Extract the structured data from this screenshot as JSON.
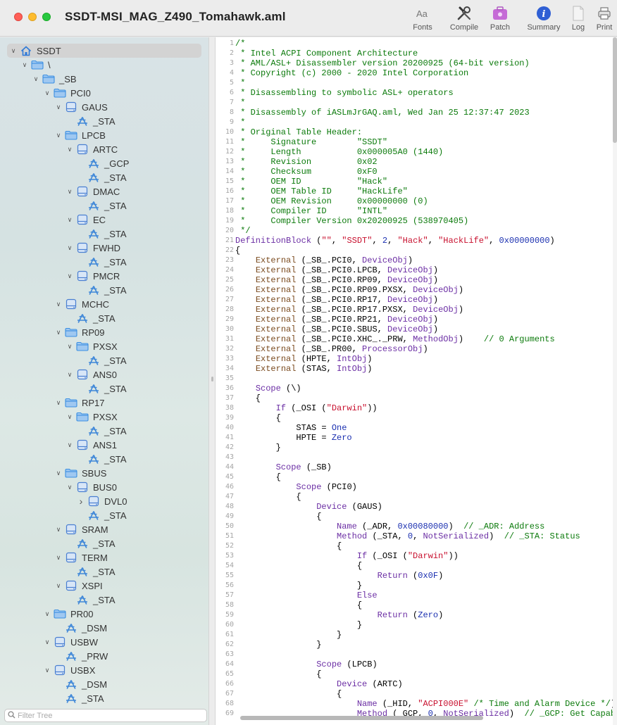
{
  "window": {
    "title": "SSDT-MSI_MAG_Z490_Tomahawk.aml"
  },
  "toolbar": {
    "fonts": {
      "label": "Fonts",
      "icon": "fonts-icon"
    },
    "compile": {
      "label": "Compile",
      "icon": "wrench-screwdriver-icon"
    },
    "patch": {
      "label": "Patch",
      "icon": "patch-case-icon"
    },
    "summary": {
      "label": "Summary",
      "icon": "info-icon"
    },
    "log": {
      "label": "Log",
      "icon": "document-icon"
    },
    "print": {
      "label": "Print",
      "icon": "printer-icon"
    }
  },
  "colors": {
    "folder": "#3b8fe2",
    "device": "#4a7fd1",
    "method": "#3d86d8",
    "selection": "#d3d3d3"
  },
  "tree": [
    {
      "label": "SSDT",
      "depth": 0,
      "icon": "house-icon",
      "expanded": true,
      "selected": true
    },
    {
      "label": "\\",
      "depth": 1,
      "icon": "folder-icon",
      "expanded": true
    },
    {
      "label": "_SB",
      "depth": 2,
      "icon": "folder-icon",
      "expanded": true
    },
    {
      "label": "PCI0",
      "depth": 3,
      "icon": "folder-icon",
      "expanded": true
    },
    {
      "label": "GAUS",
      "depth": 4,
      "icon": "device-icon",
      "expanded": true
    },
    {
      "label": "_STA",
      "depth": 5,
      "icon": "method-icon"
    },
    {
      "label": "LPCB",
      "depth": 4,
      "icon": "folder-icon",
      "expanded": true
    },
    {
      "label": "ARTC",
      "depth": 5,
      "icon": "device-icon",
      "expanded": true
    },
    {
      "label": "_GCP",
      "depth": 6,
      "icon": "method-icon"
    },
    {
      "label": "_STA",
      "depth": 6,
      "icon": "method-icon"
    },
    {
      "label": "DMAC",
      "depth": 5,
      "icon": "device-icon",
      "expanded": true
    },
    {
      "label": "_STA",
      "depth": 6,
      "icon": "method-icon"
    },
    {
      "label": "EC",
      "depth": 5,
      "icon": "device-icon",
      "expanded": true
    },
    {
      "label": "_STA",
      "depth": 6,
      "icon": "method-icon"
    },
    {
      "label": "FWHD",
      "depth": 5,
      "icon": "device-icon",
      "expanded": true
    },
    {
      "label": "_STA",
      "depth": 6,
      "icon": "method-icon"
    },
    {
      "label": "PMCR",
      "depth": 5,
      "icon": "device-icon",
      "expanded": true
    },
    {
      "label": "_STA",
      "depth": 6,
      "icon": "method-icon"
    },
    {
      "label": "MCHC",
      "depth": 4,
      "icon": "device-icon",
      "expanded": true
    },
    {
      "label": "_STA",
      "depth": 5,
      "icon": "method-icon"
    },
    {
      "label": "RP09",
      "depth": 4,
      "icon": "folder-icon",
      "expanded": true
    },
    {
      "label": "PXSX",
      "depth": 5,
      "icon": "folder-icon",
      "expanded": true
    },
    {
      "label": "_STA",
      "depth": 6,
      "icon": "method-icon"
    },
    {
      "label": "ANS0",
      "depth": 5,
      "icon": "device-icon",
      "expanded": true
    },
    {
      "label": "_STA",
      "depth": 6,
      "icon": "method-icon"
    },
    {
      "label": "RP17",
      "depth": 4,
      "icon": "folder-icon",
      "expanded": true
    },
    {
      "label": "PXSX",
      "depth": 5,
      "icon": "folder-icon",
      "expanded": true
    },
    {
      "label": "_STA",
      "depth": 6,
      "icon": "method-icon"
    },
    {
      "label": "ANS1",
      "depth": 5,
      "icon": "device-icon",
      "expanded": true
    },
    {
      "label": "_STA",
      "depth": 6,
      "icon": "method-icon"
    },
    {
      "label": "SBUS",
      "depth": 4,
      "icon": "folder-icon",
      "expanded": true
    },
    {
      "label": "BUS0",
      "depth": 5,
      "icon": "device-icon",
      "expanded": true
    },
    {
      "label": "DVL0",
      "depth": 6,
      "icon": "device-icon",
      "expanded": false
    },
    {
      "label": "_STA",
      "depth": 6,
      "icon": "method-icon"
    },
    {
      "label": "SRAM",
      "depth": 4,
      "icon": "device-icon",
      "expanded": true
    },
    {
      "label": "_STA",
      "depth": 5,
      "icon": "method-icon"
    },
    {
      "label": "TERM",
      "depth": 4,
      "icon": "device-icon",
      "expanded": true
    },
    {
      "label": "_STA",
      "depth": 5,
      "icon": "method-icon"
    },
    {
      "label": "XSPI",
      "depth": 4,
      "icon": "device-icon",
      "expanded": true
    },
    {
      "label": "_STA",
      "depth": 5,
      "icon": "method-icon"
    },
    {
      "label": "PR00",
      "depth": 3,
      "icon": "folder-icon",
      "expanded": true
    },
    {
      "label": "_DSM",
      "depth": 4,
      "icon": "method-icon"
    },
    {
      "label": "USBW",
      "depth": 3,
      "icon": "device-icon",
      "expanded": true
    },
    {
      "label": "_PRW",
      "depth": 4,
      "icon": "method-icon"
    },
    {
      "label": "USBX",
      "depth": 3,
      "icon": "device-icon",
      "expanded": true
    },
    {
      "label": "_DSM",
      "depth": 4,
      "icon": "method-icon"
    },
    {
      "label": "_STA",
      "depth": 4,
      "icon": "method-icon"
    }
  ],
  "filter": {
    "placeholder": "Filter Tree",
    "icon": "search-icon"
  },
  "code_lines": [
    [
      [
        "c",
        "/*"
      ]
    ],
    [
      [
        "c",
        " * Intel ACPI Component Architecture"
      ]
    ],
    [
      [
        "c",
        " * AML/ASL+ Disassembler version 20200925 (64-bit version)"
      ]
    ],
    [
      [
        "c",
        " * Copyright (c) 2000 - 2020 Intel Corporation"
      ]
    ],
    [
      [
        "c",
        " *"
      ]
    ],
    [
      [
        "c",
        " * Disassembling to symbolic ASL+ operators"
      ]
    ],
    [
      [
        "c",
        " *"
      ]
    ],
    [
      [
        "c",
        " * Disassembly of iASLmJrGAQ.aml, Wed Jan 25 12:37:47 2023"
      ]
    ],
    [
      [
        "c",
        " *"
      ]
    ],
    [
      [
        "c",
        " * Original Table Header:"
      ]
    ],
    [
      [
        "c",
        " *     Signature        \"SSDT\""
      ]
    ],
    [
      [
        "c",
        " *     Length           0x000005A0 (1440)"
      ]
    ],
    [
      [
        "c",
        " *     Revision         0x02"
      ]
    ],
    [
      [
        "c",
        " *     Checksum         0xF0"
      ]
    ],
    [
      [
        "c",
        " *     OEM ID           \"Hack\""
      ]
    ],
    [
      [
        "c",
        " *     OEM Table ID     \"HackLife\""
      ]
    ],
    [
      [
        "c",
        " *     OEM Revision     0x00000000 (0)"
      ]
    ],
    [
      [
        "c",
        " *     Compiler ID      \"INTL\""
      ]
    ],
    [
      [
        "c",
        " *     Compiler Version 0x20200925 (538970405)"
      ]
    ],
    [
      [
        "c",
        " */"
      ]
    ],
    [
      [
        "k",
        "DefinitionBlock"
      ],
      [
        "p",
        " ("
      ],
      [
        "s",
        "\"\""
      ],
      [
        "p",
        ", "
      ],
      [
        "s",
        "\"SSDT\""
      ],
      [
        "p",
        ", "
      ],
      [
        "n",
        "2"
      ],
      [
        "p",
        ", "
      ],
      [
        "s",
        "\"Hack\""
      ],
      [
        "p",
        ", "
      ],
      [
        "s",
        "\"HackLife\""
      ],
      [
        "p",
        ", "
      ],
      [
        "n",
        "0x00000000"
      ],
      [
        "p",
        ")"
      ]
    ],
    [
      [
        "p",
        "{"
      ]
    ],
    [
      [
        "p",
        "    "
      ],
      [
        "e",
        "External"
      ],
      [
        "p",
        " (_SB_.PCI0, "
      ],
      [
        "k",
        "DeviceObj"
      ],
      [
        "p",
        ")"
      ]
    ],
    [
      [
        "p",
        "    "
      ],
      [
        "e",
        "External"
      ],
      [
        "p",
        " (_SB_.PCI0.LPCB, "
      ],
      [
        "k",
        "DeviceObj"
      ],
      [
        "p",
        ")"
      ]
    ],
    [
      [
        "p",
        "    "
      ],
      [
        "e",
        "External"
      ],
      [
        "p",
        " (_SB_.PCI0.RP09, "
      ],
      [
        "k",
        "DeviceObj"
      ],
      [
        "p",
        ")"
      ]
    ],
    [
      [
        "p",
        "    "
      ],
      [
        "e",
        "External"
      ],
      [
        "p",
        " (_SB_.PCI0.RP09.PXSX, "
      ],
      [
        "k",
        "DeviceObj"
      ],
      [
        "p",
        ")"
      ]
    ],
    [
      [
        "p",
        "    "
      ],
      [
        "e",
        "External"
      ],
      [
        "p",
        " (_SB_.PCI0.RP17, "
      ],
      [
        "k",
        "DeviceObj"
      ],
      [
        "p",
        ")"
      ]
    ],
    [
      [
        "p",
        "    "
      ],
      [
        "e",
        "External"
      ],
      [
        "p",
        " (_SB_.PCI0.RP17.PXSX, "
      ],
      [
        "k",
        "DeviceObj"
      ],
      [
        "p",
        ")"
      ]
    ],
    [
      [
        "p",
        "    "
      ],
      [
        "e",
        "External"
      ],
      [
        "p",
        " (_SB_.PCI0.RP21, "
      ],
      [
        "k",
        "DeviceObj"
      ],
      [
        "p",
        ")"
      ]
    ],
    [
      [
        "p",
        "    "
      ],
      [
        "e",
        "External"
      ],
      [
        "p",
        " (_SB_.PCI0.SBUS, "
      ],
      [
        "k",
        "DeviceObj"
      ],
      [
        "p",
        ")"
      ]
    ],
    [
      [
        "p",
        "    "
      ],
      [
        "e",
        "External"
      ],
      [
        "p",
        " (_SB_.PCI0.XHC_._PRW, "
      ],
      [
        "k",
        "MethodObj"
      ],
      [
        "p",
        ")    "
      ],
      [
        "c",
        "// 0 Arguments"
      ]
    ],
    [
      [
        "p",
        "    "
      ],
      [
        "e",
        "External"
      ],
      [
        "p",
        " (_SB_.PR00, "
      ],
      [
        "k",
        "ProcessorObj"
      ],
      [
        "p",
        ")"
      ]
    ],
    [
      [
        "p",
        "    "
      ],
      [
        "e",
        "External"
      ],
      [
        "p",
        " (HPTE, "
      ],
      [
        "k",
        "IntObj"
      ],
      [
        "p",
        ")"
      ]
    ],
    [
      [
        "p",
        "    "
      ],
      [
        "e",
        "External"
      ],
      [
        "p",
        " (STAS, "
      ],
      [
        "k",
        "IntObj"
      ],
      [
        "p",
        ")"
      ]
    ],
    [
      [
        "p",
        ""
      ]
    ],
    [
      [
        "p",
        "    "
      ],
      [
        "k",
        "Scope"
      ],
      [
        "p",
        " (\\)"
      ]
    ],
    [
      [
        "p",
        "    {"
      ]
    ],
    [
      [
        "p",
        "        "
      ],
      [
        "k",
        "If"
      ],
      [
        "p",
        " (_OSI ("
      ],
      [
        "s",
        "\"Darwin\""
      ],
      [
        "p",
        "))"
      ]
    ],
    [
      [
        "p",
        "        {"
      ]
    ],
    [
      [
        "p",
        "            STAS = "
      ],
      [
        "n",
        "One"
      ]
    ],
    [
      [
        "p",
        "            HPTE = "
      ],
      [
        "n",
        "Zero"
      ]
    ],
    [
      [
        "p",
        "        }"
      ]
    ],
    [
      [
        "p",
        ""
      ]
    ],
    [
      [
        "p",
        "        "
      ],
      [
        "k",
        "Scope"
      ],
      [
        "p",
        " (_SB)"
      ]
    ],
    [
      [
        "p",
        "        {"
      ]
    ],
    [
      [
        "p",
        "            "
      ],
      [
        "k",
        "Scope"
      ],
      [
        "p",
        " (PCI0)"
      ]
    ],
    [
      [
        "p",
        "            {"
      ]
    ],
    [
      [
        "p",
        "                "
      ],
      [
        "k",
        "Device"
      ],
      [
        "p",
        " (GAUS)"
      ]
    ],
    [
      [
        "p",
        "                {"
      ]
    ],
    [
      [
        "p",
        "                    "
      ],
      [
        "k",
        "Name"
      ],
      [
        "p",
        " (_ADR, "
      ],
      [
        "n",
        "0x00080000"
      ],
      [
        "p",
        ")  "
      ],
      [
        "c",
        "// _ADR: Address"
      ]
    ],
    [
      [
        "p",
        "                    "
      ],
      [
        "k",
        "Method"
      ],
      [
        "p",
        " (_STA, "
      ],
      [
        "n",
        "0"
      ],
      [
        "p",
        ", "
      ],
      [
        "k",
        "NotSerialized"
      ],
      [
        "p",
        ")  "
      ],
      [
        "c",
        "// _STA: Status"
      ]
    ],
    [
      [
        "p",
        "                    {"
      ]
    ],
    [
      [
        "p",
        "                        "
      ],
      [
        "k",
        "If"
      ],
      [
        "p",
        " (_OSI ("
      ],
      [
        "s",
        "\"Darwin\""
      ],
      [
        "p",
        "))"
      ]
    ],
    [
      [
        "p",
        "                        {"
      ]
    ],
    [
      [
        "p",
        "                            "
      ],
      [
        "k",
        "Return"
      ],
      [
        "p",
        " ("
      ],
      [
        "n",
        "0x0F"
      ],
      [
        "p",
        ")"
      ]
    ],
    [
      [
        "p",
        "                        }"
      ]
    ],
    [
      [
        "p",
        "                        "
      ],
      [
        "k",
        "Else"
      ]
    ],
    [
      [
        "p",
        "                        {"
      ]
    ],
    [
      [
        "p",
        "                            "
      ],
      [
        "k",
        "Return"
      ],
      [
        "p",
        " ("
      ],
      [
        "n",
        "Zero"
      ],
      [
        "p",
        ")"
      ]
    ],
    [
      [
        "p",
        "                        }"
      ]
    ],
    [
      [
        "p",
        "                    }"
      ]
    ],
    [
      [
        "p",
        "                }"
      ]
    ],
    [
      [
        "p",
        ""
      ]
    ],
    [
      [
        "p",
        "                "
      ],
      [
        "k",
        "Scope"
      ],
      [
        "p",
        " (LPCB)"
      ]
    ],
    [
      [
        "p",
        "                {"
      ]
    ],
    [
      [
        "p",
        "                    "
      ],
      [
        "k",
        "Device"
      ],
      [
        "p",
        " (ARTC)"
      ]
    ],
    [
      [
        "p",
        "                    {"
      ]
    ],
    [
      [
        "p",
        "                        "
      ],
      [
        "k",
        "Name"
      ],
      [
        "p",
        " (_HID, "
      ],
      [
        "s",
        "\"ACPI000E\""
      ],
      [
        "p",
        " "
      ],
      [
        "c",
        "/* Time and Alarm Device */"
      ],
      [
        "p",
        ")"
      ]
    ],
    [
      [
        "p",
        "                        "
      ],
      [
        "k",
        "Method"
      ],
      [
        "p",
        " (_GCP, "
      ],
      [
        "n",
        "0"
      ],
      [
        "p",
        ", "
      ],
      [
        "k",
        "NotSerialized"
      ],
      [
        "p",
        ")  "
      ],
      [
        "c",
        "// _GCP: Get Capab"
      ]
    ]
  ]
}
